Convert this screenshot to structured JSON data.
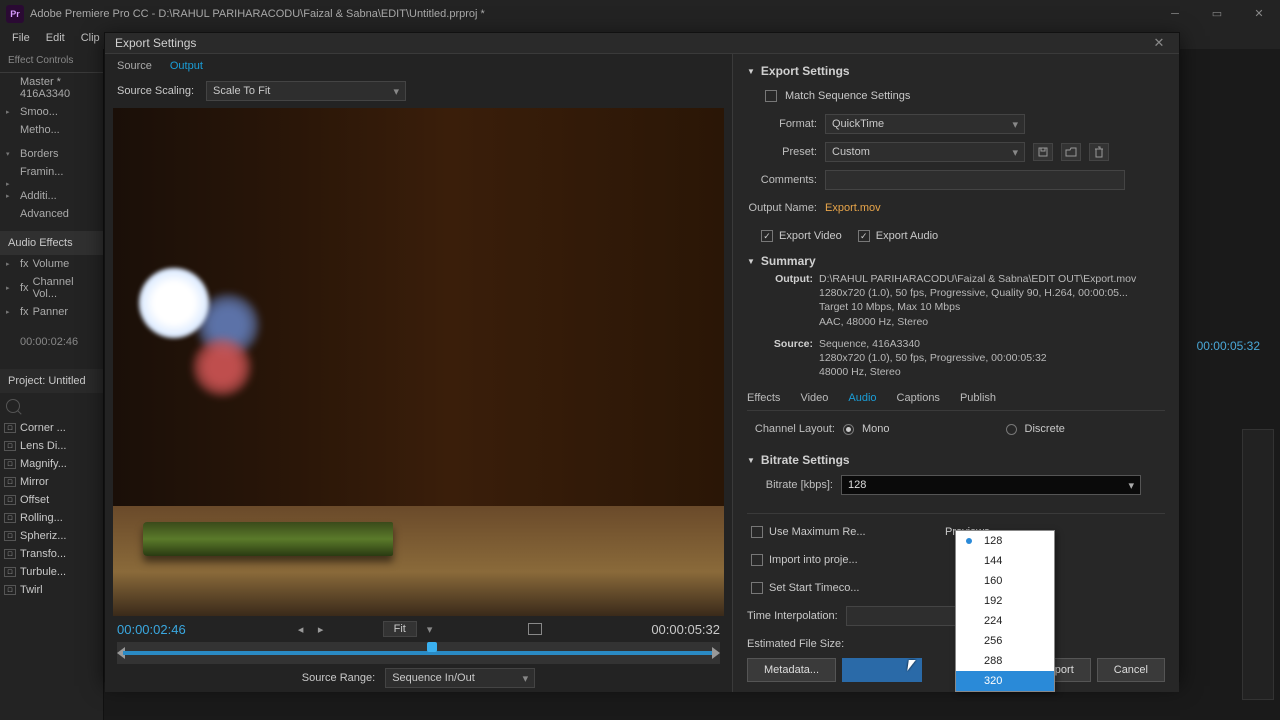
{
  "app": {
    "logo": "Pr",
    "title": "Adobe Premiere Pro CC - D:\\RAHUL PARIHARACODU\\Faizal & Sabna\\EDIT\\Untitled.prproj *",
    "menus": [
      "File",
      "Edit",
      "Clip"
    ]
  },
  "bg": {
    "effect_controls": "Effect Controls",
    "master": "Master * 416A3340",
    "items1": [
      "Smoo...",
      "Metho...",
      " "
    ],
    "borders": "Borders",
    "items2": [
      "Framin...",
      " ",
      "Additi...",
      "Advanced"
    ],
    "audiofx": "Audio Effects",
    "items3": [
      "Volume",
      "Channel Vol...",
      "Panner"
    ],
    "tc": "00:00:02:46",
    "project": "Project: Untitled",
    "fxlist": [
      "Corner ...",
      "Lens Di...",
      "Magnify...",
      "Mirror",
      "Offset",
      "Rolling...",
      "Spheriz...",
      "Transfo...",
      "Turbule...",
      "Twirl"
    ],
    "tc_right": "00:00:05:32"
  },
  "dialog": {
    "title": "Export Settings",
    "tabs": {
      "source": "Source",
      "output": "Output"
    },
    "source_scaling": {
      "label": "Source Scaling:",
      "value": "Scale To Fit"
    },
    "tc_left": "00:00:02:46",
    "fit": "Fit",
    "tc_right": "00:00:05:32",
    "source_range": {
      "label": "Source Range:",
      "value": "Sequence In/Out"
    }
  },
  "export": {
    "heading": "Export Settings",
    "match": "Match Sequence Settings",
    "format": {
      "label": "Format:",
      "value": "QuickTime"
    },
    "preset": {
      "label": "Preset:",
      "value": "Custom"
    },
    "comments": "Comments:",
    "output_name": {
      "label": "Output Name:",
      "value": "Export.mov"
    },
    "export_video": "Export Video",
    "export_audio": "Export Audio",
    "summary": "Summary",
    "sum_output_label": "Output:",
    "sum_output": [
      "D:\\RAHUL PARIHARACODU\\Faizal & Sabna\\EDIT OUT\\Export.mov",
      "1280x720 (1.0), 50 fps, Progressive, Quality 90, H.264, 00:00:05...",
      "Target 10 Mbps, Max 10 Mbps",
      "AAC, 48000 Hz, Stereo"
    ],
    "sum_source_label": "Source:",
    "sum_source": [
      "Sequence, 416A3340",
      "1280x720 (1.0), 50 fps, Progressive, 00:00:05:32",
      "48000 Hz, Stereo"
    ],
    "tabs": {
      "effects": "Effects",
      "video": "Video",
      "audio": "Audio",
      "captions": "Captions",
      "publish": "Publish"
    },
    "channel": {
      "label": "Channel Layout:",
      "mono": "Mono",
      "discrete": "Discrete"
    },
    "bitrate_heading": "Bitrate Settings",
    "bitrate": {
      "label": "Bitrate [kbps]:",
      "value": "128",
      "options": [
        "128",
        "144",
        "160",
        "192",
        "224",
        "256",
        "288",
        "320"
      ],
      "hover": "320"
    },
    "use_max": "Use Maximum Re...",
    "use_previews": "Previews",
    "import_proj": "Import into proje...",
    "set_tc": "Set Start Timeco...",
    "time_interp": "Time Interpolation:",
    "est_size": "Estimated File Size:",
    "metadata": "Metadata...",
    "export_btn": "Export",
    "cancel_btn": "Cancel"
  }
}
